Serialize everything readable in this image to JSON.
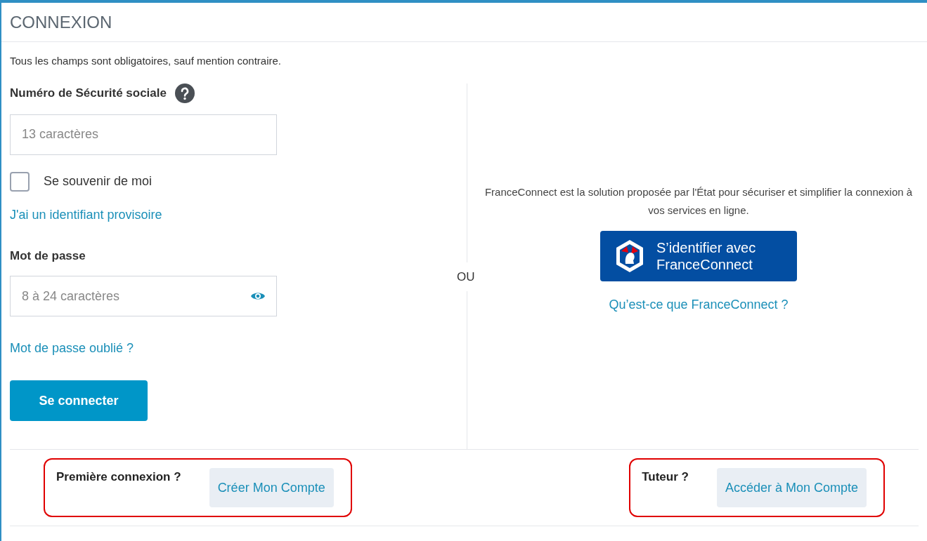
{
  "title": "CONNEXION",
  "intro": "Tous les champs sont obligatoires, sauf mention contraire.",
  "ssn": {
    "label": "Numéro de Sécurité sociale",
    "placeholder": "13 caractères"
  },
  "remember": {
    "label": "Se souvenir de moi",
    "checked": false
  },
  "temp_id_link": "J'ai un identifiant provisoire",
  "password": {
    "label": "Mot de passe",
    "placeholder": "8 à 24 caractères"
  },
  "forgot_link": "Mot de passe oublié ?",
  "submit": "Se connecter",
  "separator": "OU",
  "franceconnect": {
    "description": "FranceConnect est la solution proposée par l'État pour sécuriser et simplifier la connexion à vos services en ligne.",
    "button_lines": [
      "S’identifier avec",
      "FranceConnect"
    ],
    "info_link": "Qu’est-ce que FranceConnect ?"
  },
  "footer": [
    {
      "label": "Première connexion ?",
      "button": "Créer Mon Compte",
      "highlighted": true
    },
    {
      "label": "Tuteur ?",
      "button": "Accéder à Mon Compte",
      "highlighted": true
    }
  ]
}
